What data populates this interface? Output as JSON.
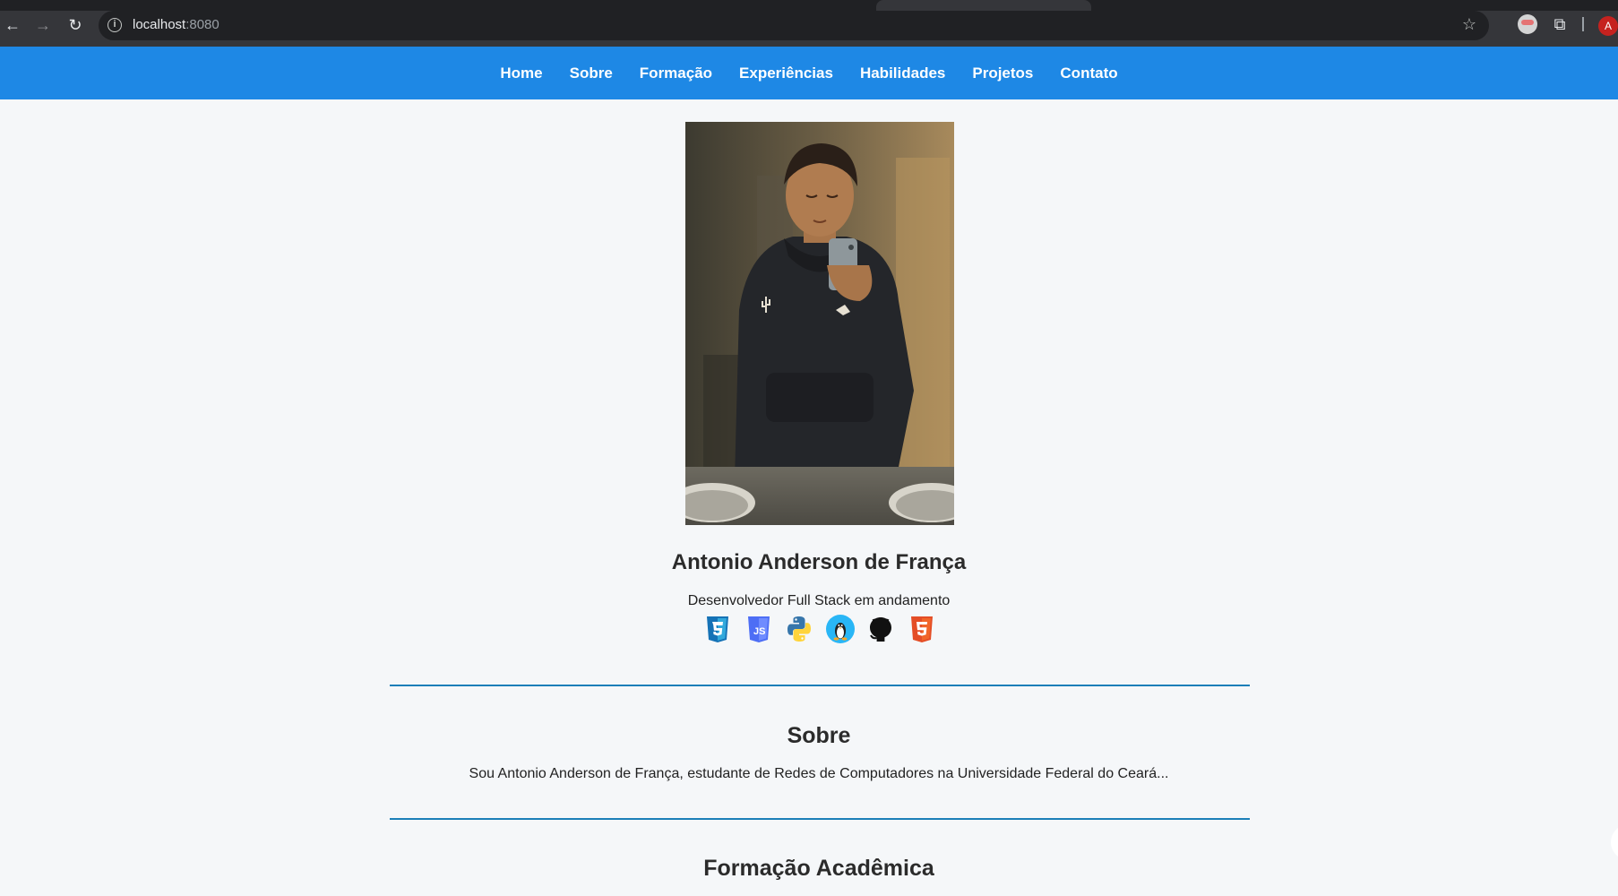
{
  "browser": {
    "url_host": "localhost",
    "url_port": ":8080",
    "profile_initial": "A",
    "icons": [
      "back-icon",
      "forward-icon",
      "reload-icon",
      "site-info-icon",
      "star-icon",
      "extension-icon",
      "puzzle-icon"
    ]
  },
  "nav": {
    "items": [
      "Home",
      "Sobre",
      "Formação",
      "Experiências",
      "Habilidades",
      "Projetos",
      "Contato"
    ]
  },
  "profile": {
    "name": "Antonio Anderson de França",
    "role": "Desenvolvedor Full Stack em andamento",
    "skills": [
      "css3-icon",
      "javascript-icon",
      "python-icon",
      "linux-icon",
      "github-icon",
      "html5-icon"
    ]
  },
  "sections": {
    "sobre_title": "Sobre",
    "sobre_text": "Sou Antonio Anderson de França, estudante de Redes de Computadores na Universidade Federal do Ceará...",
    "formacao_title": "Formação Acadêmica"
  },
  "colors": {
    "nav_bg": "#1e88e5",
    "rule": "#1b7fb8",
    "page_bg": "#f5f7f9"
  }
}
